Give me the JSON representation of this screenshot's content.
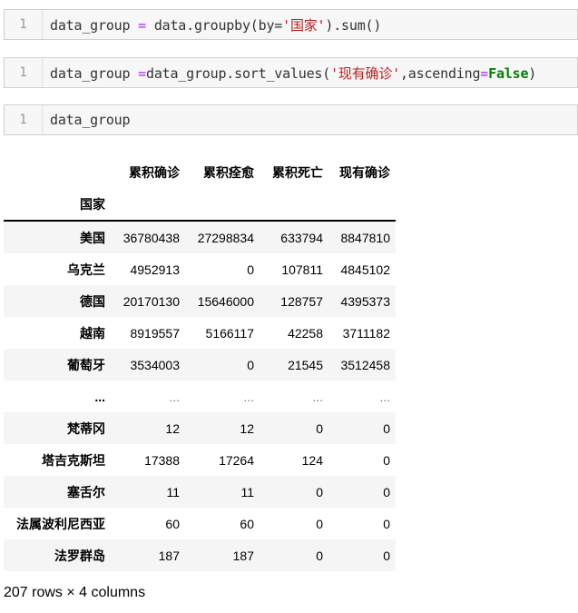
{
  "cells": [
    {
      "number": "1",
      "tokens": [
        {
          "t": "data_group ",
          "c": "plain"
        },
        {
          "t": "=",
          "c": "op"
        },
        {
          "t": " data.groupby(by=",
          "c": "plain"
        },
        {
          "t": "'国家'",
          "c": "str"
        },
        {
          "t": ").sum()",
          "c": "plain"
        }
      ]
    },
    {
      "number": "1",
      "tokens": [
        {
          "t": "data_group ",
          "c": "plain"
        },
        {
          "t": "=",
          "c": "op"
        },
        {
          "t": "data_group.sort_values(",
          "c": "plain"
        },
        {
          "t": "'现有确诊'",
          "c": "str"
        },
        {
          "t": ",ascending",
          "c": "plain"
        },
        {
          "t": "=",
          "c": "op"
        },
        {
          "t": "False",
          "c": "kw"
        },
        {
          "t": ")",
          "c": "plain"
        }
      ]
    },
    {
      "number": "1",
      "tokens": [
        {
          "t": "data_group",
          "c": "plain"
        }
      ]
    }
  ],
  "dataframe": {
    "columns": [
      "累积确诊",
      "累积痊愈",
      "累积死亡",
      "现有确诊"
    ],
    "index_name": "国家",
    "rows": [
      {
        "index": "美国",
        "values": [
          "36780438",
          "27298834",
          "633794",
          "8847810"
        ]
      },
      {
        "index": "乌克兰",
        "values": [
          "4952913",
          "0",
          "107811",
          "4845102"
        ]
      },
      {
        "index": "德国",
        "values": [
          "20170130",
          "15646000",
          "128757",
          "4395373"
        ]
      },
      {
        "index": "越南",
        "values": [
          "8919557",
          "5166117",
          "42258",
          "3711182"
        ]
      },
      {
        "index": "葡萄牙",
        "values": [
          "3534003",
          "0",
          "21545",
          "3512458"
        ]
      },
      {
        "index": "...",
        "values": [
          "...",
          "...",
          "...",
          "..."
        ],
        "ellipsis": true
      },
      {
        "index": "梵蒂冈",
        "values": [
          "12",
          "12",
          "0",
          "0"
        ]
      },
      {
        "index": "塔吉克斯坦",
        "values": [
          "17388",
          "17264",
          "124",
          "0"
        ]
      },
      {
        "index": "塞舌尔",
        "values": [
          "11",
          "11",
          "0",
          "0"
        ]
      },
      {
        "index": "法属波利尼西亚",
        "values": [
          "60",
          "60",
          "0",
          "0"
        ]
      },
      {
        "index": "法罗群岛",
        "values": [
          "187",
          "187",
          "0",
          "0"
        ]
      }
    ],
    "shape_text": "207 rows × 4 columns"
  }
}
